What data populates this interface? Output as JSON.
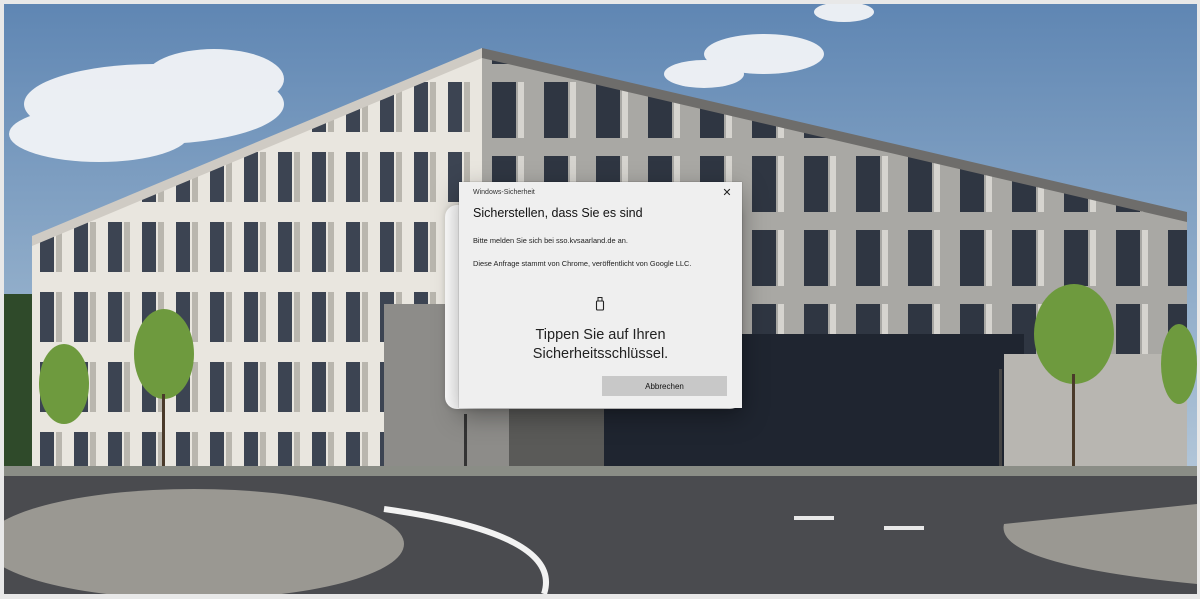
{
  "dialog": {
    "window_title": "Windows-Sicherheit",
    "close_glyph": "✕",
    "heading": "Sicherstellen, dass Sie es sind",
    "signin_text": "Bitte melden Sie sich bei sso.kvsaarland.de an.",
    "request_text": "Diese Anfrage stammt von Chrome, veröffentlicht von Google LLC.",
    "key_icon": "usb-security-key-icon",
    "prompt_line1": "Tippen Sie auf Ihren",
    "prompt_line2": "Sicherheitsschlüssel.",
    "cancel_label": "Abbrechen"
  },
  "colors": {
    "dialog_bg": "#efefef",
    "button_bg": "#c8c8c8",
    "sky": "#9ab3cc"
  }
}
